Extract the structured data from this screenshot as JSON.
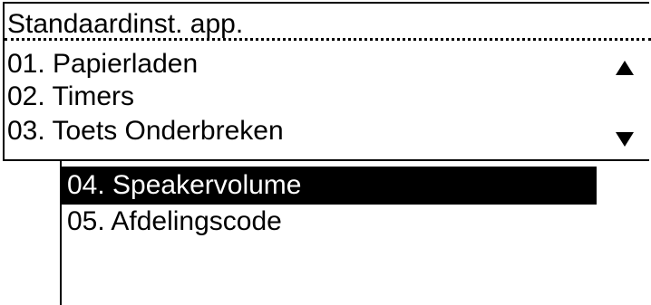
{
  "screen": {
    "title": "Standaardinst. app.",
    "items": [
      {
        "label": "01. Papierladen"
      },
      {
        "label": "02. Timers"
      },
      {
        "label": "03. Toets Onderbreken"
      },
      {
        "label": "04. Speakervolume",
        "selected": true
      },
      {
        "label": "05. Afdelingscode"
      }
    ],
    "scroll_up_icon": "triangle-up",
    "scroll_down_icon": "triangle-down"
  }
}
